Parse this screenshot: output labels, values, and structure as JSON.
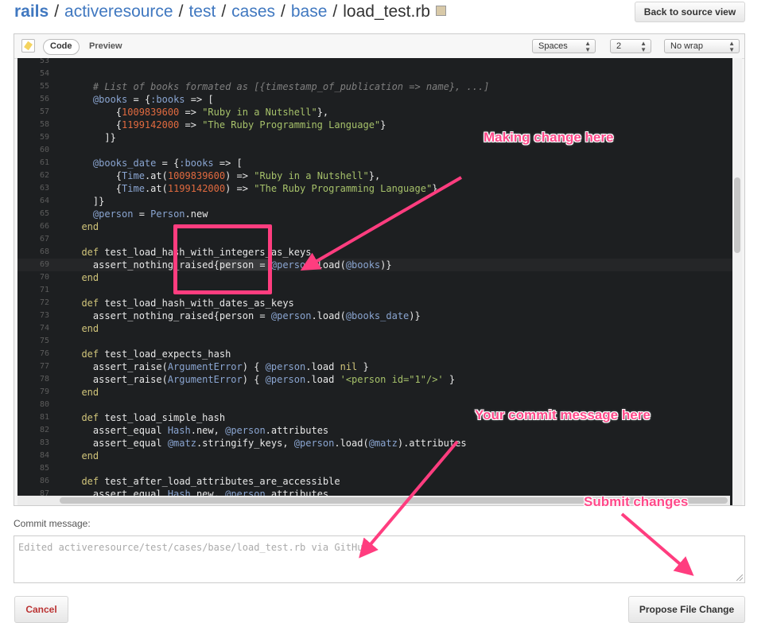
{
  "breadcrumb": {
    "root": "rails",
    "segments": [
      "activeresource",
      "test",
      "cases",
      "base"
    ],
    "separator": "/",
    "file": "load_test.rb"
  },
  "header": {
    "back_label": "Back to source view"
  },
  "editor": {
    "tabs": {
      "code": "Code",
      "preview": "Preview"
    },
    "indent_mode": "Spaces",
    "indent_size": "2",
    "wrap_mode": "No wrap"
  },
  "code_lines": [
    {
      "n": "53",
      "tokens": []
    },
    {
      "n": "54",
      "tokens": []
    },
    {
      "n": "55",
      "tokens": [
        [
          "",
          "    "
        ],
        [
          "t-com",
          "# List of books formated as [{timestamp_of_publication => name}, ...]"
        ]
      ]
    },
    {
      "n": "56",
      "tokens": [
        [
          "",
          "    "
        ],
        [
          "t-ivar",
          "@books"
        ],
        [
          "",
          " = {"
        ],
        [
          "t-sym",
          ":books"
        ],
        [
          "",
          " => ["
        ]
      ]
    },
    {
      "n": "57",
      "tokens": [
        [
          "",
          "        {"
        ],
        [
          "t-num",
          "1009839600"
        ],
        [
          "",
          " => "
        ],
        [
          "t-str",
          "\"Ruby in a Nutshell\""
        ],
        [
          "",
          "},"
        ]
      ]
    },
    {
      "n": "58",
      "tokens": [
        [
          "",
          "        {"
        ],
        [
          "t-num",
          "1199142000"
        ],
        [
          "",
          " => "
        ],
        [
          "t-str",
          "\"The Ruby Programming Language\""
        ],
        [
          "",
          "}"
        ]
      ]
    },
    {
      "n": "59",
      "tokens": [
        [
          "",
          "      ]}"
        ]
      ]
    },
    {
      "n": "60",
      "tokens": []
    },
    {
      "n": "61",
      "tokens": [
        [
          "",
          "    "
        ],
        [
          "t-ivar",
          "@books_date"
        ],
        [
          "",
          " = {"
        ],
        [
          "t-sym",
          ":books"
        ],
        [
          "",
          " => ["
        ]
      ]
    },
    {
      "n": "62",
      "tokens": [
        [
          "",
          "        {"
        ],
        [
          "t-const",
          "Time"
        ],
        [
          "",
          ".at("
        ],
        [
          "t-num",
          "1009839600"
        ],
        [
          "",
          ") => "
        ],
        [
          "t-str",
          "\"Ruby in a Nutshell\""
        ],
        [
          "",
          "},"
        ]
      ]
    },
    {
      "n": "63",
      "tokens": [
        [
          "",
          "        {"
        ],
        [
          "t-const",
          "Time"
        ],
        [
          "",
          ".at("
        ],
        [
          "t-num",
          "1199142000"
        ],
        [
          "",
          ") => "
        ],
        [
          "t-str",
          "\"The Ruby Programming Language\""
        ],
        [
          "",
          "}"
        ]
      ]
    },
    {
      "n": "64",
      "tokens": [
        [
          "",
          "    ]}"
        ]
      ]
    },
    {
      "n": "65",
      "tokens": [
        [
          "",
          "    "
        ],
        [
          "t-ivar",
          "@person"
        ],
        [
          "",
          " = "
        ],
        [
          "t-const",
          "Person"
        ],
        [
          "",
          ".new"
        ]
      ]
    },
    {
      "n": "66",
      "tokens": [
        [
          "t-kw",
          "  end"
        ]
      ]
    },
    {
      "n": "67",
      "tokens": []
    },
    {
      "n": "68",
      "tokens": [
        [
          "t-kw",
          "  def"
        ],
        [
          "",
          " test_load_hash_with_integers_as_keys"
        ]
      ]
    },
    {
      "n": "69",
      "active": true,
      "tokens": [
        [
          "",
          "    assert_nothing_raised{"
        ],
        [
          "t-hl",
          "person = "
        ],
        [
          "t-ivar",
          "@person"
        ],
        [
          "",
          ".load("
        ],
        [
          "t-ivar",
          "@books"
        ],
        [
          "",
          ")}"
        ]
      ]
    },
    {
      "n": "70",
      "tokens": [
        [
          "t-kw",
          "  end"
        ]
      ]
    },
    {
      "n": "71",
      "tokens": []
    },
    {
      "n": "72",
      "tokens": [
        [
          "t-kw",
          "  def"
        ],
        [
          "",
          " test_load_hash_with_dates_as_keys"
        ]
      ]
    },
    {
      "n": "73",
      "tokens": [
        [
          "",
          "    assert_nothing_raised{person = "
        ],
        [
          "t-ivar",
          "@person"
        ],
        [
          "",
          ".load("
        ],
        [
          "t-ivar",
          "@books_date"
        ],
        [
          "",
          ")}"
        ]
      ]
    },
    {
      "n": "74",
      "tokens": [
        [
          "t-kw",
          "  end"
        ]
      ]
    },
    {
      "n": "75",
      "tokens": []
    },
    {
      "n": "76",
      "tokens": [
        [
          "t-kw",
          "  def"
        ],
        [
          "",
          " test_load_expects_hash"
        ]
      ]
    },
    {
      "n": "77",
      "tokens": [
        [
          "",
          "    assert_raise("
        ],
        [
          "t-const",
          "ArgumentError"
        ],
        [
          "",
          ") { "
        ],
        [
          "t-ivar",
          "@person"
        ],
        [
          "",
          ".load "
        ],
        [
          "t-nil",
          "nil"
        ],
        [
          "",
          " }"
        ]
      ]
    },
    {
      "n": "78",
      "tokens": [
        [
          "",
          "    assert_raise("
        ],
        [
          "t-const",
          "ArgumentError"
        ],
        [
          "",
          ") { "
        ],
        [
          "t-ivar",
          "@person"
        ],
        [
          "",
          ".load "
        ],
        [
          "t-str",
          "'<person id=\"1\"/>'"
        ],
        [
          "",
          " }"
        ]
      ]
    },
    {
      "n": "79",
      "tokens": [
        [
          "t-kw",
          "  end"
        ]
      ]
    },
    {
      "n": "80",
      "tokens": []
    },
    {
      "n": "81",
      "tokens": [
        [
          "t-kw",
          "  def"
        ],
        [
          "",
          " test_load_simple_hash"
        ]
      ]
    },
    {
      "n": "82",
      "tokens": [
        [
          "",
          "    assert_equal "
        ],
        [
          "t-const",
          "Hash"
        ],
        [
          "",
          ".new, "
        ],
        [
          "t-ivar",
          "@person"
        ],
        [
          "",
          ".attributes"
        ]
      ]
    },
    {
      "n": "83",
      "tokens": [
        [
          "",
          "    assert_equal "
        ],
        [
          "t-ivar",
          "@matz"
        ],
        [
          "",
          ".stringify_keys, "
        ],
        [
          "t-ivar",
          "@person"
        ],
        [
          "",
          ".load("
        ],
        [
          "t-ivar",
          "@matz"
        ],
        [
          "",
          ").attributes"
        ]
      ]
    },
    {
      "n": "84",
      "tokens": [
        [
          "t-kw",
          "  end"
        ]
      ]
    },
    {
      "n": "85",
      "tokens": []
    },
    {
      "n": "86",
      "tokens": [
        [
          "t-kw",
          "  def"
        ],
        [
          "",
          " test_after_load_attributes_are_accessible"
        ]
      ]
    },
    {
      "n": "87",
      "tokens": [
        [
          "",
          "    assert_equal "
        ],
        [
          "t-const",
          "Hash"
        ],
        [
          "",
          ".new, "
        ],
        [
          "t-ivar",
          "@person"
        ],
        [
          "",
          ".attributes"
        ]
      ]
    }
  ],
  "commit": {
    "label": "Commit message:",
    "placeholder": "Edited activeresource/test/cases/base/load_test.rb via GitHub"
  },
  "actions": {
    "cancel": "Cancel",
    "propose": "Propose File Change"
  },
  "annotations": {
    "change": "Making change here",
    "message": "Your commit message here",
    "submit": "Submit changes"
  },
  "colors": {
    "link": "#4078c0",
    "annotation": "#ff4a8a",
    "editor_bg": "#1d1f21",
    "cancel_text": "#b33333"
  },
  "icons": [
    "copy-icon",
    "edit-icon"
  ]
}
